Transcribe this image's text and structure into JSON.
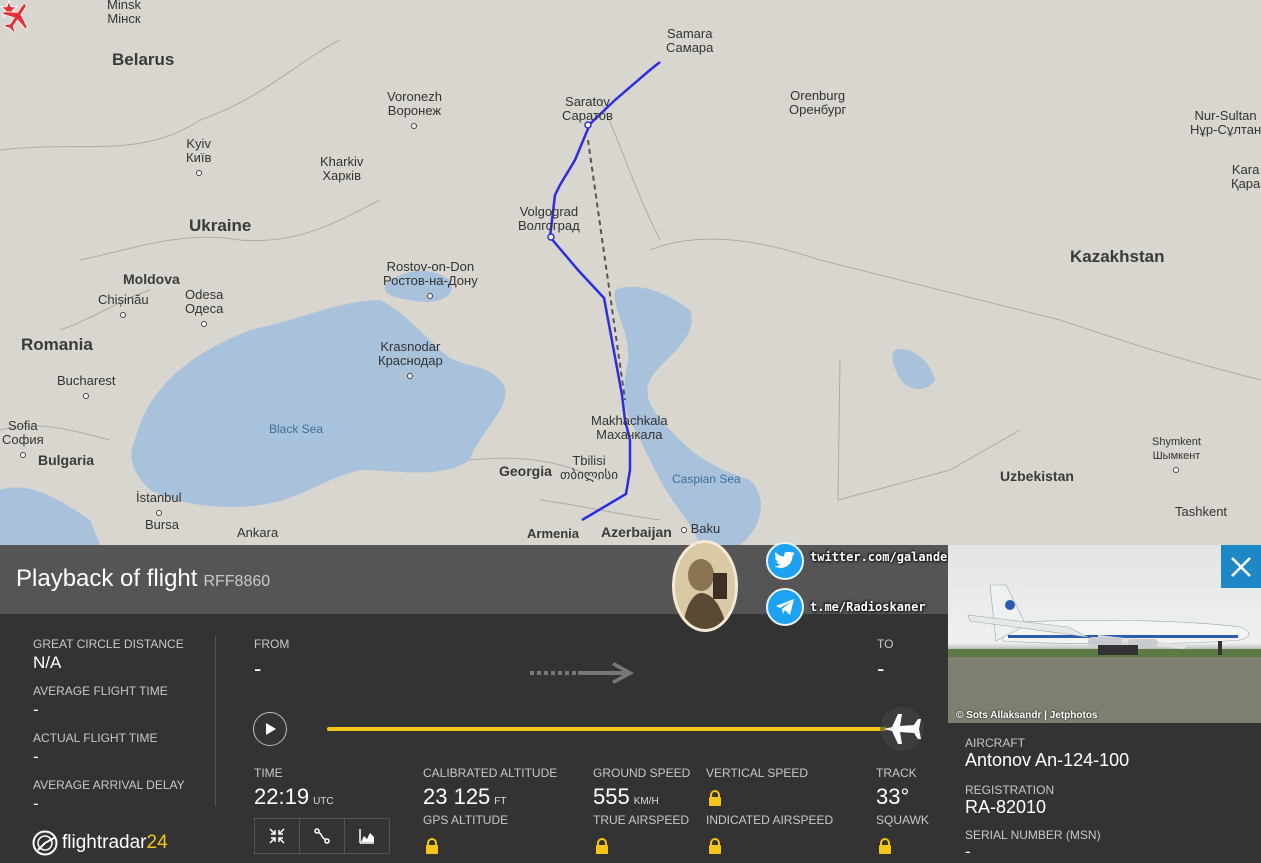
{
  "map": {
    "cities": [
      {
        "en": "Minsk",
        "local": "Мінск"
      },
      {
        "en": "Samara",
        "local": "Самара"
      },
      {
        "en": "Voronezh",
        "local": "Воронеж"
      },
      {
        "en": "Saratov",
        "local": "Саратов"
      },
      {
        "en": "Orenburg",
        "local": "Оренбург"
      },
      {
        "en": "Nur-Sultan",
        "local": "Нұр-Сұлтан"
      },
      {
        "en": "Kyiv",
        "local": "Київ"
      },
      {
        "en": "Kharkiv",
        "local": "Харків"
      },
      {
        "en": "Kara",
        "local": "Қара"
      },
      {
        "en": "Volgograd",
        "local": "Волгоград"
      },
      {
        "en": "Rostov-on-Don",
        "local": "Ростов-на-Дону"
      },
      {
        "en": "Chișinău",
        "local": ""
      },
      {
        "en": "Odesa",
        "local": "Одеса"
      },
      {
        "en": "Krasnodar",
        "local": "Краснодар"
      },
      {
        "en": "Bucharest",
        "local": ""
      },
      {
        "en": "Sofia",
        "local": "София"
      },
      {
        "en": "Makhachkala",
        "local": "Махачкала"
      },
      {
        "en": "Tbilisi",
        "local": "თბილისი"
      },
      {
        "en": "Shymkent",
        "local": "Шымкент"
      },
      {
        "en": "İstanbul",
        "local": ""
      },
      {
        "en": "Bursa",
        "local": ""
      },
      {
        "en": "Ankara",
        "local": ""
      },
      {
        "en": "Baku",
        "local": ""
      },
      {
        "en": "Tashkent",
        "local": ""
      }
    ],
    "countries": [
      "Belarus",
      "Ukraine",
      "Moldova",
      "Romania",
      "Bulgaria",
      "Georgia",
      "Armenia",
      "Azerbaijan",
      "Kazakhstan",
      "Uzbekistan"
    ],
    "seas": [
      "Black Sea",
      "Caspian Sea"
    ]
  },
  "social": {
    "twitter": "twitter.com/galandecZP",
    "telegram": "t.me/Radioskaner"
  },
  "playback": {
    "title": "Playback of flight",
    "callsign": "RFF8860",
    "stats": [
      {
        "label": "GREAT CIRCLE DISTANCE",
        "value": "N/A"
      },
      {
        "label": "AVERAGE FLIGHT TIME",
        "value": "-"
      },
      {
        "label": "ACTUAL FLIGHT TIME",
        "value": "-"
      },
      {
        "label": "AVERAGE ARRIVAL DELAY",
        "value": "-"
      }
    ],
    "from_label": "FROM",
    "from_value": "-",
    "to_label": "TO",
    "to_value": "-",
    "progress": 1.0,
    "time_label": "TIME",
    "time_value": "22:19",
    "time_unit": "UTC",
    "cal_alt_label": "CALIBRATED ALTITUDE",
    "cal_alt_value": "23 125",
    "cal_alt_unit": "FT",
    "gps_alt_label": "GPS ALTITUDE",
    "ground_speed_label": "GROUND SPEED",
    "ground_speed_value": "555",
    "ground_speed_unit": "KM/H",
    "true_airspeed_label": "TRUE AIRSPEED",
    "vertical_speed_label": "VERTICAL SPEED",
    "indicated_airspeed_label": "INDICATED AIRSPEED",
    "track_label": "TRACK",
    "track_value": "33°",
    "squawk_label": "SQUAWK"
  },
  "logo": {
    "text": "flightradar",
    "num": "24"
  },
  "aircraft": {
    "photo_credit": "© Sots Allaksandr | Jetphotos",
    "aircraft_label": "AIRCRAFT",
    "aircraft_value": "Antonov An-124-100",
    "registration_label": "REGISTRATION",
    "registration_value": "RA-82010",
    "serial_label": "SERIAL NUMBER (MSN)",
    "serial_value": "-"
  },
  "colors": {
    "track": "#2b2fe0",
    "progress": "#f5c518",
    "close": "#1e88c7",
    "plane_marker": "#e8303a"
  },
  "icons": [
    "plane-icon",
    "star-icon",
    "play-icon",
    "lock-icon",
    "close-icon",
    "twitter-icon",
    "telegram-icon",
    "arrow-right-icon",
    "collapse-icon",
    "route-icon",
    "chart-icon",
    "flightradar-logo-icon"
  ]
}
